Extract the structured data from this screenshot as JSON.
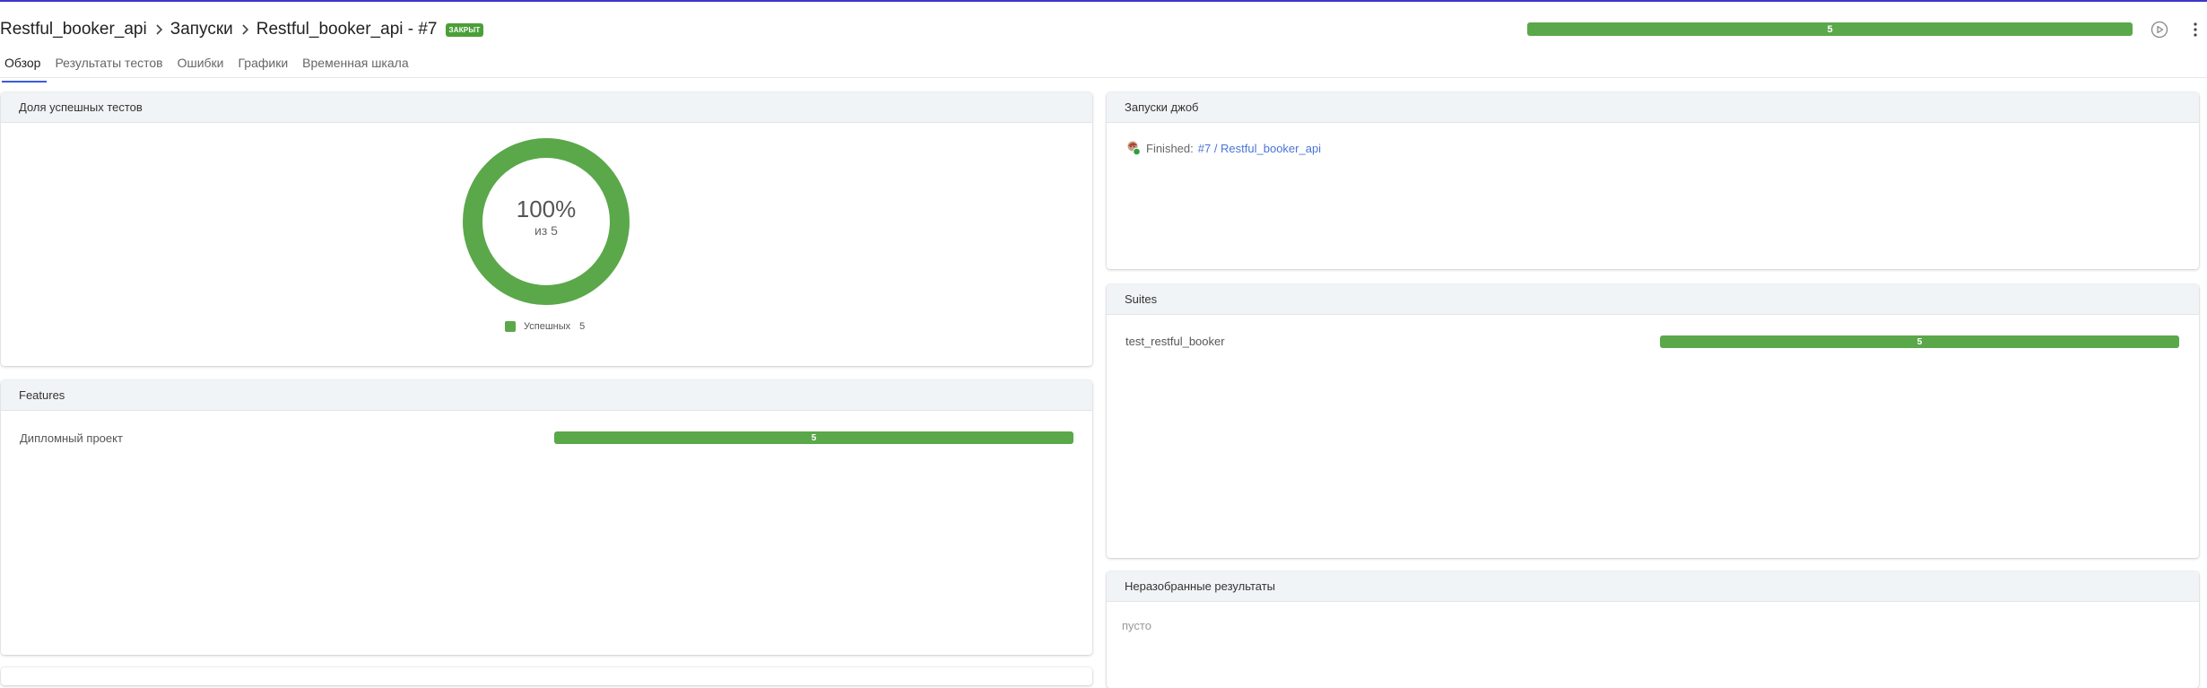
{
  "header": {
    "breadcrumb": {
      "project": "Restful_booker_api",
      "section": "Запуски",
      "launch": "Restful_booker_api - #7"
    },
    "status_badge": "ЗАКРЫТ",
    "progress": {
      "value": 5,
      "label": "5",
      "passed_fraction": 1.0,
      "color": "#5aa84a"
    }
  },
  "tabs": [
    {
      "label": "Обзор",
      "active": true
    },
    {
      "label": "Результаты тестов",
      "active": false
    },
    {
      "label": "Ошибки",
      "active": false
    },
    {
      "label": "Графики",
      "active": false
    },
    {
      "label": "Временная шкала",
      "active": false
    }
  ],
  "success_panel": {
    "title": "Доля успешных тестов",
    "percent_label": "100%",
    "total_label": "из 5",
    "passed_fraction": 1.0,
    "legend": {
      "label": "Успешных",
      "count": "5",
      "color": "#5aa84a"
    }
  },
  "features_panel": {
    "title": "Features",
    "items": [
      {
        "name": "Дипломный проект",
        "count": "5",
        "passed_fraction": 1.0
      }
    ]
  },
  "jobs_panel": {
    "title": "Запуски джоб",
    "items": [
      {
        "status": "Finished:",
        "link": "#7 / Restful_booker_api",
        "icon": "jenkins-avatar-icon"
      }
    ]
  },
  "suites_panel": {
    "title": "Suites",
    "items": [
      {
        "name": "test_restful_booker",
        "count": "5",
        "passed_fraction": 1.0
      }
    ]
  },
  "unsorted_panel": {
    "title": "Неразобранные результаты",
    "empty_text": "пусто"
  },
  "colors": {
    "accent": "#3b5bdb",
    "passed": "#5aa84a",
    "badge": "#4c9f38",
    "link": "#4a74d8"
  }
}
